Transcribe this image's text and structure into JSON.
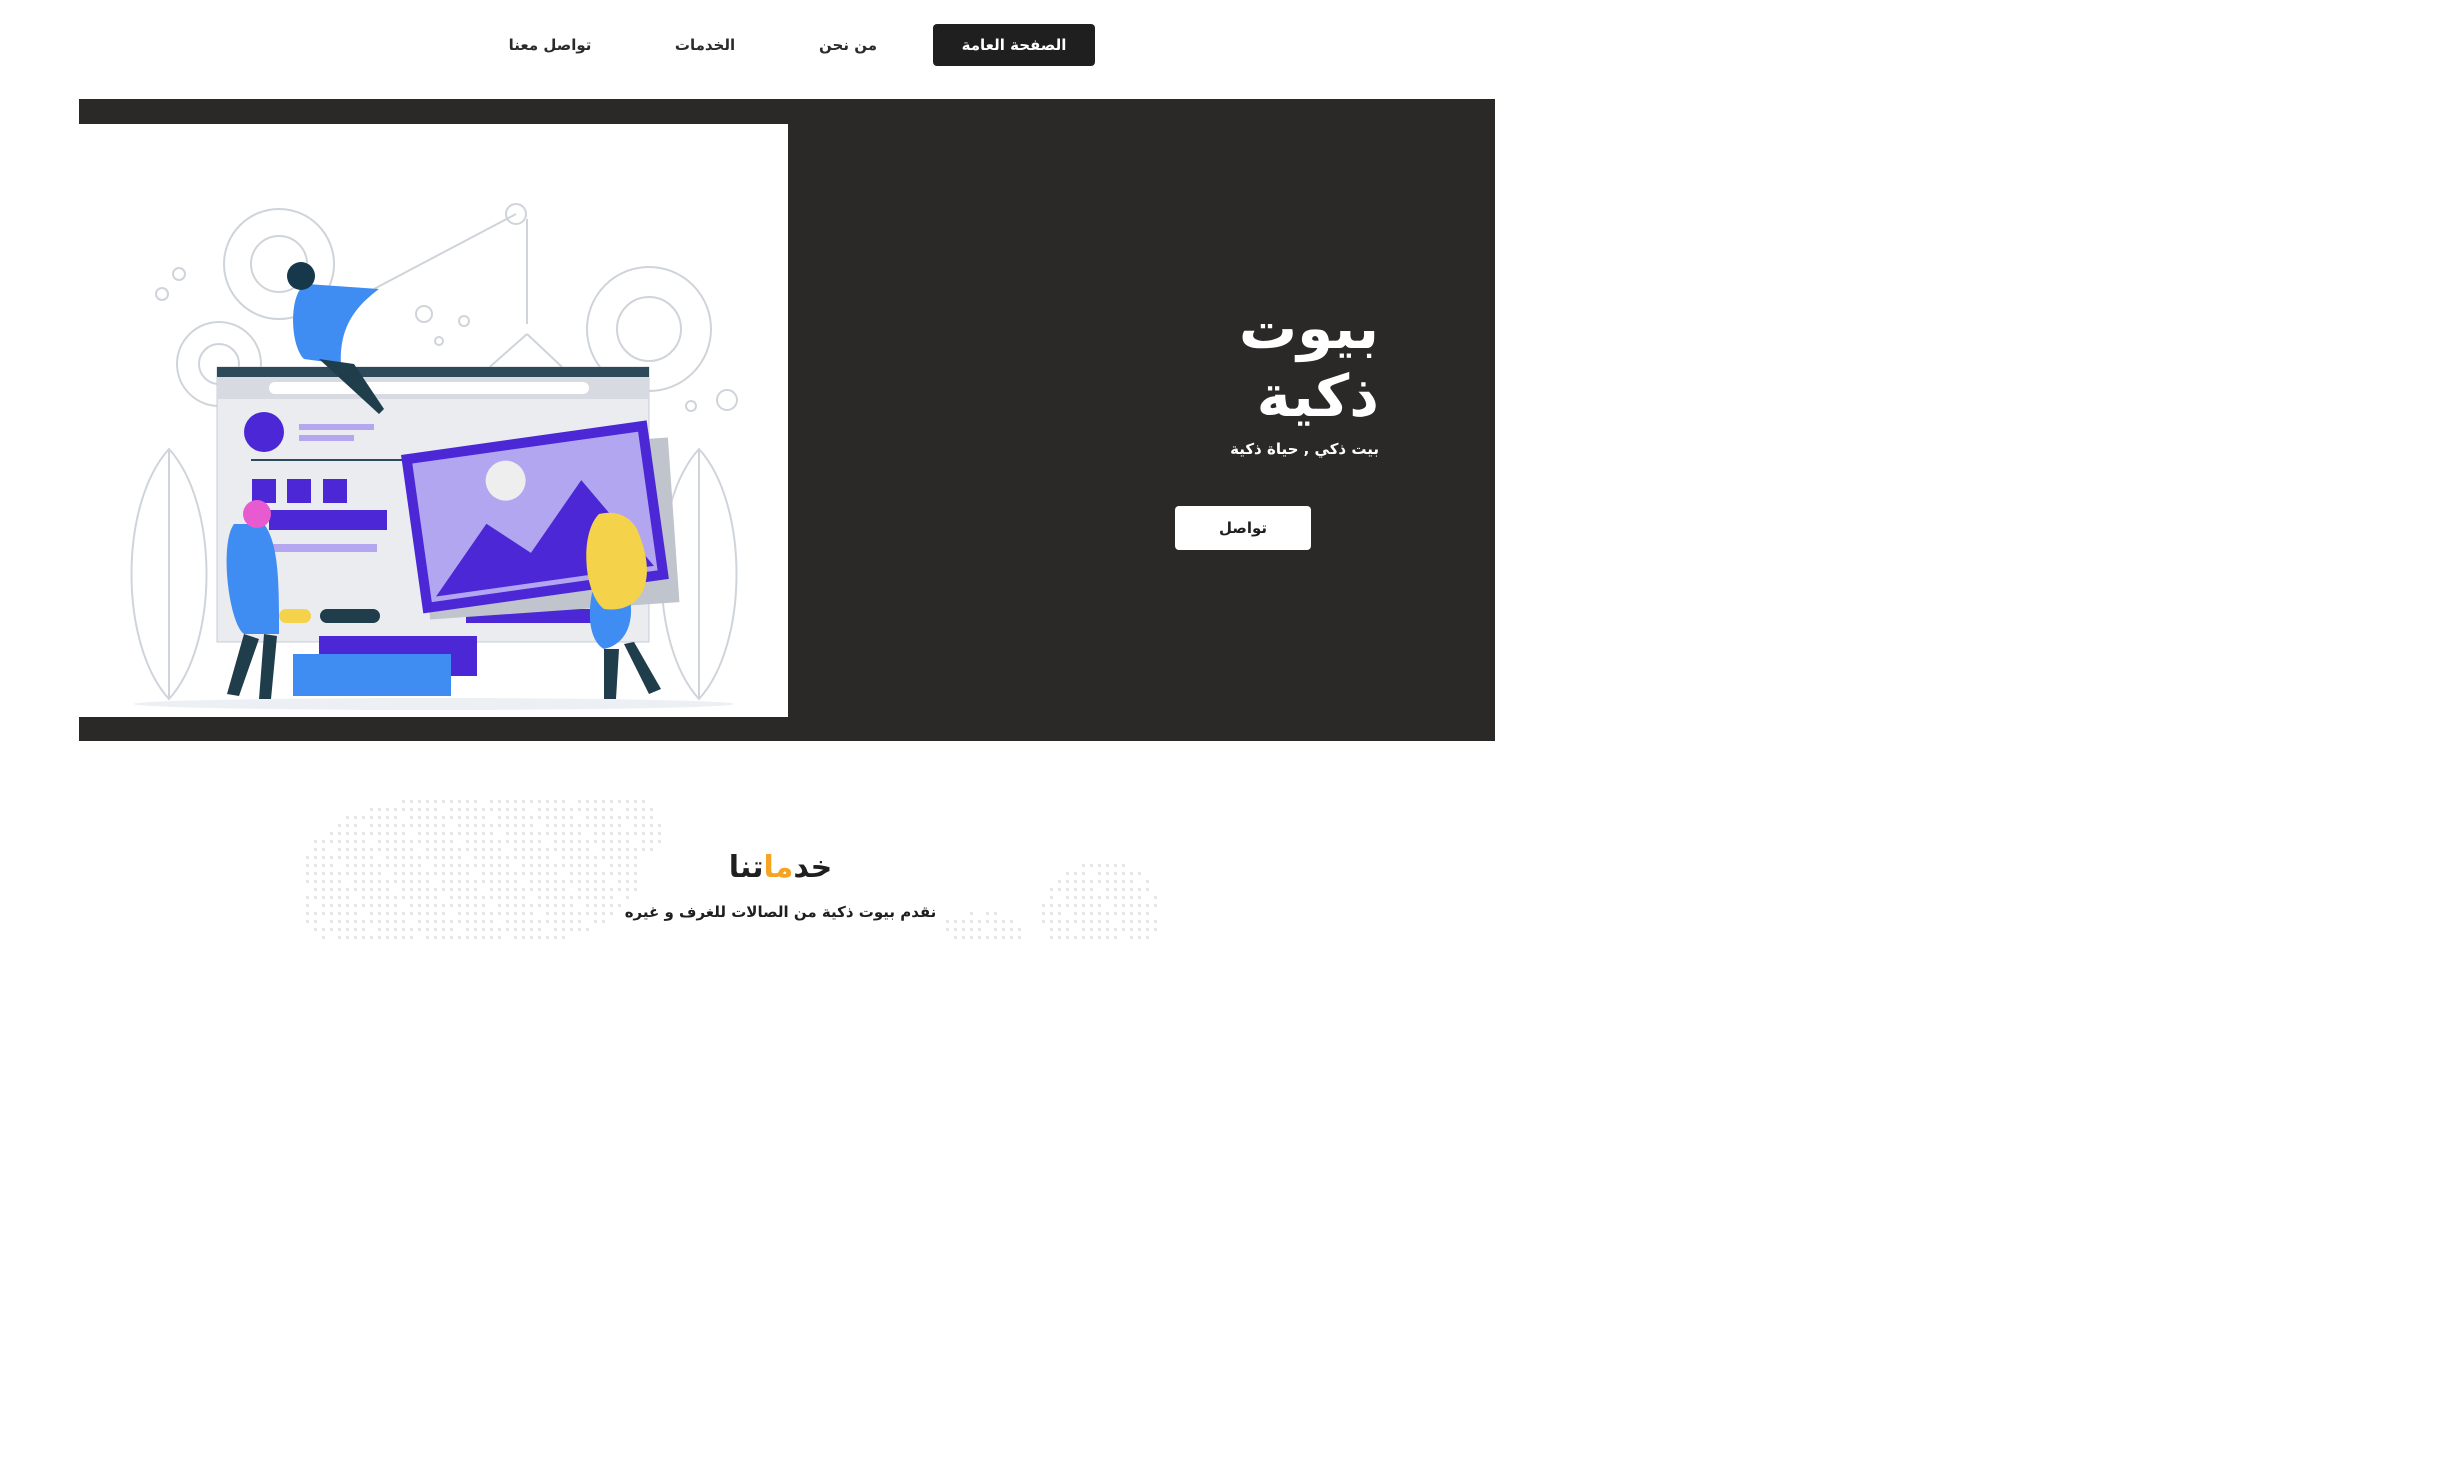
{
  "nav": {
    "items": [
      {
        "label": "الصفحة العامة",
        "active": true
      },
      {
        "label": "من نحن",
        "active": false
      },
      {
        "label": "الخدمات",
        "active": false
      },
      {
        "label": "تواصل معنا",
        "active": false
      }
    ]
  },
  "hero": {
    "title": "بيوت ذكية",
    "subtitle": "بيت ذكي , حياة ذكية",
    "cta_label": "تواصل",
    "background_color": "#2b2828",
    "illustration_icon": "web-design-team-illustration"
  },
  "services": {
    "title_part1": "خد",
    "title_accent": "ما",
    "title_part2": "تنا",
    "subtitle": "نقدم بيوت ذكية من الصالات للغرف و غيره",
    "accent_color": "#f4a422"
  }
}
